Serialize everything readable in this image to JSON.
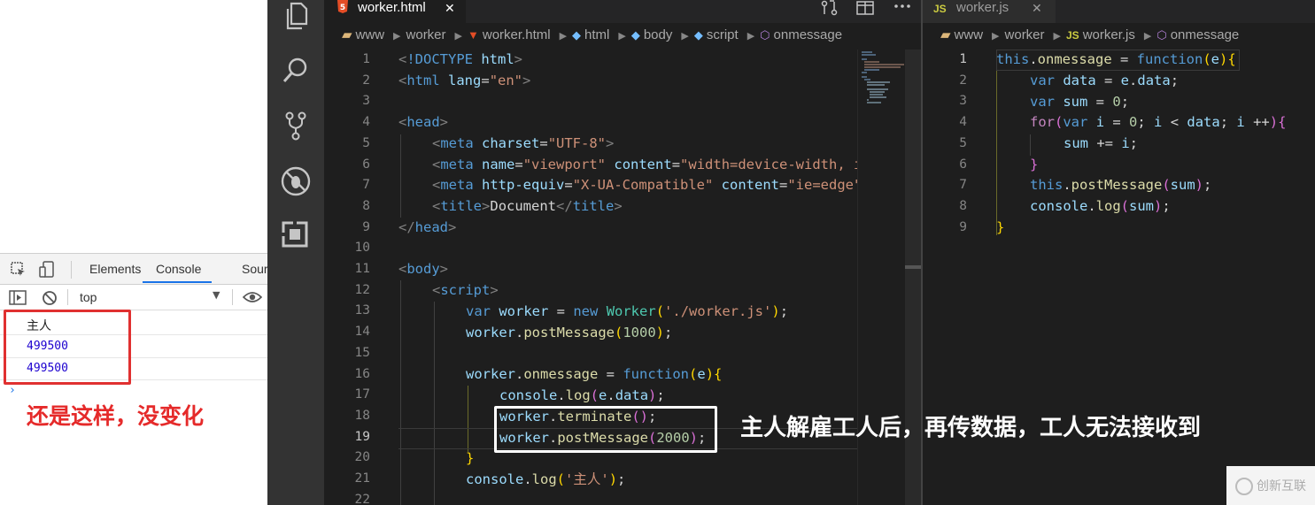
{
  "devtools": {
    "tabs": [
      "Elements",
      "Console",
      "Sour"
    ],
    "active_tab": "Console",
    "context": "top",
    "console_lines": [
      "主人",
      "499500",
      "499500"
    ],
    "prompt": "›"
  },
  "annotations": {
    "left_note": "还是这样，没变化",
    "right_note": "主人解雇工人后，再传数据，工人无法接收到",
    "watermark": "创新互联"
  },
  "editor_left": {
    "tab_label": "worker.html",
    "tab_close": "✕",
    "tab_icon": "5",
    "breadcrumbs": [
      "www",
      "worker",
      "worker.html",
      "html",
      "body",
      "script",
      "onmessage"
    ],
    "line_numbers": [
      "1",
      "2",
      "3",
      "4",
      "5",
      "6",
      "7",
      "8",
      "9",
      "10",
      "11",
      "12",
      "13",
      "14",
      "15",
      "16",
      "17",
      "18",
      "19",
      "20",
      "21",
      "22"
    ]
  },
  "editor_right": {
    "tab_label": "worker.js",
    "tab_close": "✕",
    "tab_icon": "JS",
    "breadcrumbs": [
      "www",
      "worker",
      "worker.js",
      "onmessage"
    ],
    "line_numbers": [
      "1",
      "2",
      "3",
      "4",
      "5",
      "6",
      "7",
      "8",
      "9"
    ]
  },
  "icons": {
    "activity": [
      "files-icon",
      "search-icon",
      "source-control-icon",
      "debug-icon",
      "extensions-icon"
    ],
    "tab_actions": [
      "compare-icon",
      "split-editor-icon",
      "more-icon"
    ]
  },
  "colors": {
    "red_annotation": "#e52a2a",
    "editor_bg": "#1e1e1e",
    "activity_bg": "#333333"
  }
}
